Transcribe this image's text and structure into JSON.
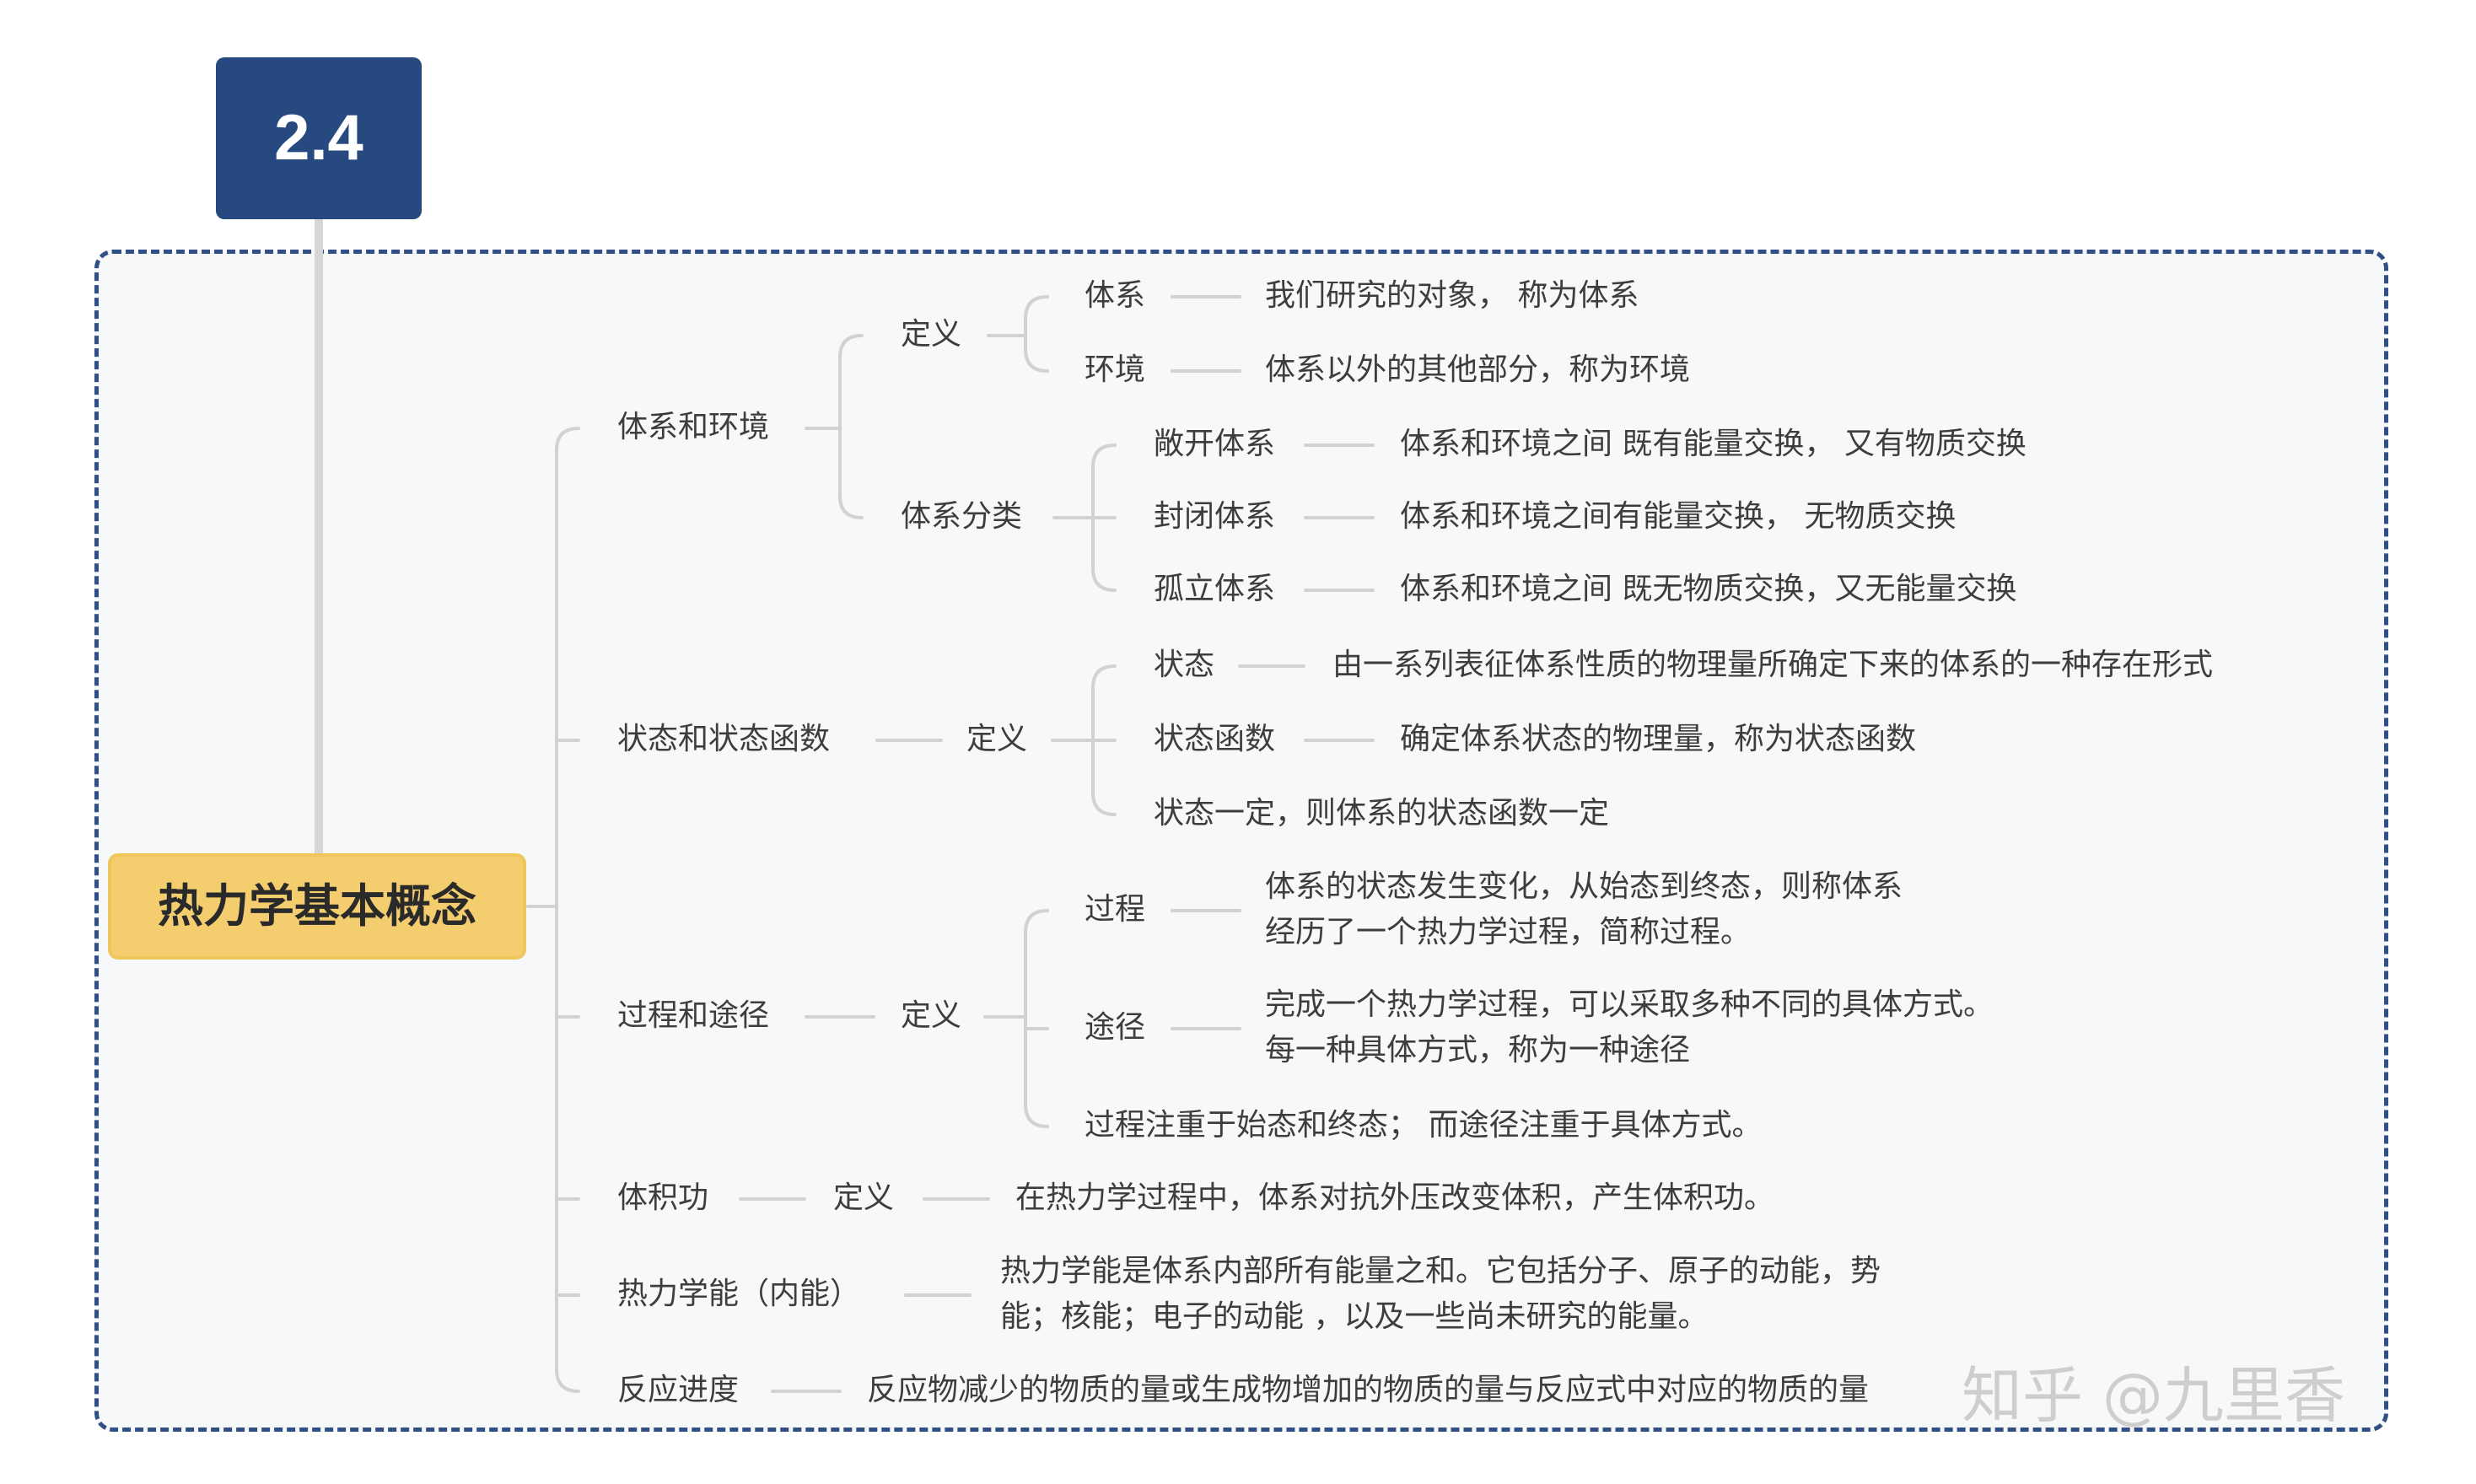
{
  "section_tag": "2.4",
  "root_title": "热力学基本概念",
  "watermark": "知乎 @九里香",
  "branches": {
    "system_env": {
      "label": "体系和环境",
      "def_label": "定义",
      "system": {
        "term": "体系",
        "desc": "我们研究的对象，  称为体系"
      },
      "environment": {
        "term": "环境",
        "desc": "体系以外的其他部分，称为环境"
      },
      "classify_label": "体系分类",
      "open": {
        "term": "敞开体系",
        "desc": "体系和环境之间 既有能量交换，  又有物质交换"
      },
      "closed": {
        "term": "封闭体系",
        "desc": "体系和环境之间有能量交换，  无物质交换"
      },
      "isolated": {
        "term": "孤立体系",
        "desc": "体系和环境之间 既无物质交换，又无能量交换"
      }
    },
    "state": {
      "label": "状态和状态函数",
      "def_label": "定义",
      "state": {
        "term": "状态",
        "desc": "由一系列表征体系性质的物理量所确定下来的体系的一种存在形式"
      },
      "state_function": {
        "term": "状态函数",
        "desc": "确定体系状态的物理量，称为状态函数"
      },
      "note": "状态一定，则体系的状态函数一定"
    },
    "process": {
      "label": "过程和途径",
      "def_label": "定义",
      "process": {
        "term": "过程",
        "desc": "体系的状态发生变化，从始态到终态，则称体系\n经历了一个热力学过程，简称过程。"
      },
      "path": {
        "term": "途径",
        "desc": "完成一个热力学过程，可以采取多种不同的具体方式。\n每一种具体方式，称为一种途径"
      },
      "note": "过程注重于始态和终态；  而途径注重于具体方式。"
    },
    "volume_work": {
      "label": "体积功",
      "def_label": "定义",
      "desc": "在热力学过程中，体系对抗外压改变体积，产生体积功。"
    },
    "internal_energy": {
      "label": "热力学能（内能）",
      "desc": "热力学能是体系内部所有能量之和。它包括分子、原子的动能，势\n能；核能；电子的动能 ，以及一些尚未研究的能量。"
    },
    "reaction_extent": {
      "label": "反应进度",
      "desc": "反应物减少的物质的量或生成物增加的物质的量与反应式中对应的物质的量"
    }
  },
  "colors": {
    "tag_bg": "#264a80",
    "root_bg": "#f4cd6e",
    "frame_border": "#2f4f86",
    "connector": "#d2d2d2",
    "text": "#3d3d3d"
  }
}
